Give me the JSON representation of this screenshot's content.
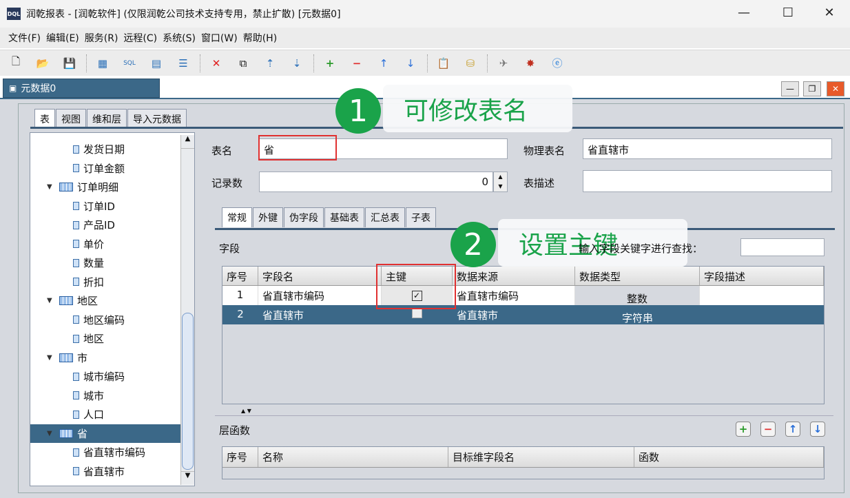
{
  "window": {
    "logo": "DQL",
    "title": "润乾报表 - [润乾软件] (仅限润乾公司技术支持专用，禁止扩散)  [元数据0]",
    "min": "—",
    "max": "☐",
    "close": "✕"
  },
  "menu": [
    "文件(F)",
    "编辑(E)",
    "服务(R)",
    "远程(C)",
    "系统(S)",
    "窗口(W)",
    "帮助(H)"
  ],
  "doc_tab": "元数据0",
  "doc_controls": [
    "—",
    "❐",
    "✕"
  ],
  "left_tabs": [
    "表",
    "视图",
    "维和层",
    "导入元数据"
  ],
  "tree": [
    {
      "label": "发货日期",
      "type": "field"
    },
    {
      "label": "订单金额",
      "type": "field"
    },
    {
      "label": "订单明细",
      "type": "table"
    },
    {
      "label": "订单ID",
      "type": "field"
    },
    {
      "label": "产品ID",
      "type": "field"
    },
    {
      "label": "单价",
      "type": "field"
    },
    {
      "label": "数量",
      "type": "field"
    },
    {
      "label": "折扣",
      "type": "field"
    },
    {
      "label": "地区",
      "type": "table"
    },
    {
      "label": "地区编码",
      "type": "field"
    },
    {
      "label": "地区",
      "type": "field"
    },
    {
      "label": "市",
      "type": "table"
    },
    {
      "label": "城市编码",
      "type": "field"
    },
    {
      "label": "城市",
      "type": "field"
    },
    {
      "label": "人口",
      "type": "field"
    },
    {
      "label": "省",
      "type": "table",
      "selected": true
    },
    {
      "label": "省直辖市编码",
      "type": "field"
    },
    {
      "label": "省直辖市",
      "type": "field"
    }
  ],
  "form": {
    "table_name_label": "表名",
    "table_name": "省",
    "physical_label": "物理表名",
    "physical": "省直辖市",
    "records_label": "记录数",
    "records": "0",
    "desc_label": "表描述",
    "desc": ""
  },
  "sub_tabs": [
    "常规",
    "外键",
    "伪字段",
    "基础表",
    "汇总表",
    "子表"
  ],
  "fields": {
    "label": "字段",
    "search_label": "输入字段关键字进行查找：",
    "search_value": "",
    "columns": [
      "序号",
      "字段名",
      "主键",
      "数据来源",
      "数据类型",
      "字段描述"
    ],
    "rows": [
      {
        "no": "1",
        "name": "省直辖市编码",
        "pk": true,
        "source": "省直辖市编码",
        "type": "整数",
        "desc": ""
      },
      {
        "no": "2",
        "name": "省直辖市",
        "pk": false,
        "source": "省直辖市",
        "type": "字符串",
        "desc": ""
      }
    ]
  },
  "level_func": {
    "label": "层函数",
    "columns": [
      "序号",
      "名称",
      "目标维字段名",
      "函数"
    ],
    "buttons": [
      "+",
      "−",
      "↑",
      "↓"
    ]
  },
  "annotations": [
    {
      "num": "1",
      "text": "可修改表名"
    },
    {
      "num": "2",
      "text": "设置主键"
    }
  ],
  "colors": {
    "accent": "#3b6888",
    "annotation": "#1aa34a",
    "highlight": "#e03030"
  }
}
